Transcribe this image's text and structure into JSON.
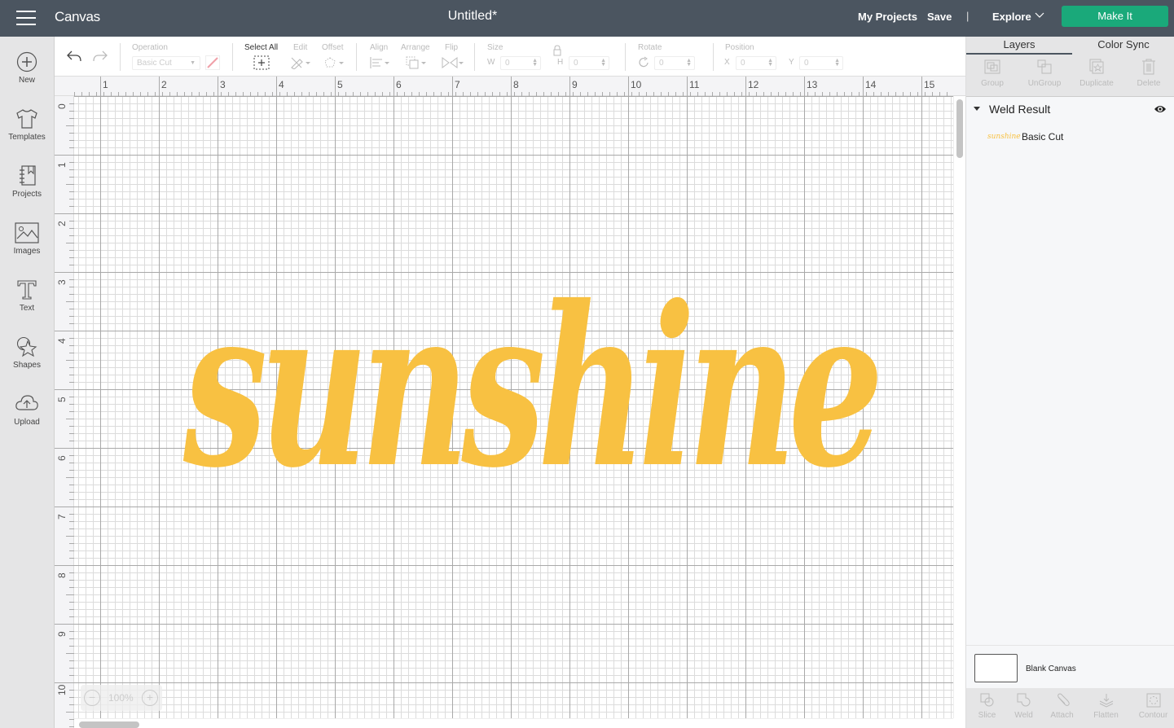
{
  "header": {
    "app_name": "Canvas",
    "doc_title": "Untitled*",
    "my_projects": "My Projects",
    "save": "Save",
    "divider": "|",
    "explore": "Explore",
    "make_it": "Make It",
    "colors": {
      "bar": "#4b5560",
      "make_it": "#1aa97a"
    }
  },
  "leftnav": {
    "items": [
      {
        "label": "New",
        "icon": "plus-circle-icon"
      },
      {
        "label": "Templates",
        "icon": "tshirt-icon"
      },
      {
        "label": "Projects",
        "icon": "notebook-icon"
      },
      {
        "label": "Images",
        "icon": "image-icon"
      },
      {
        "label": "Text",
        "icon": "text-icon"
      },
      {
        "label": "Shapes",
        "icon": "shapes-icon"
      },
      {
        "label": "Upload",
        "icon": "cloud-upload-icon"
      }
    ]
  },
  "toolbar": {
    "operation_label": "Operation",
    "operation_value": "Basic Cut",
    "select_all": "Select All",
    "edit": "Edit",
    "offset": "Offset",
    "align": "Align",
    "arrange": "Arrange",
    "flip": "Flip",
    "size": "Size",
    "w_label": "W",
    "w_value": "0",
    "h_label": "H",
    "h_value": "0",
    "rotate": "Rotate",
    "rotate_value": "0",
    "position": "Position",
    "x_label": "X",
    "x_value": "0",
    "y_label": "Y",
    "y_value": "0"
  },
  "rulers": {
    "top": [
      "1",
      "2",
      "3",
      "4",
      "5",
      "6",
      "7",
      "8",
      "9",
      "10",
      "11",
      "12",
      "13",
      "14",
      "15"
    ],
    "left": [
      "0",
      "1",
      "2",
      "3",
      "4",
      "5",
      "6",
      "7",
      "8",
      "9",
      "10"
    ]
  },
  "canvas": {
    "artwork_text": "sunshine",
    "artwork_color": "#f8c142",
    "zoom": "100%",
    "zoom_out": "−",
    "zoom_in": "+"
  },
  "panel": {
    "tabs": [
      "Layers",
      "Color Sync"
    ],
    "tools": [
      "Group",
      "UnGroup",
      "Duplicate",
      "Delete"
    ],
    "group_name": "Weld Result",
    "layer_thumb": "sunshine",
    "layer_name": "Basic Cut",
    "blank_canvas": "Blank Canvas",
    "bottom_tools": [
      "Slice",
      "Weld",
      "Attach",
      "Flatten",
      "Contour"
    ]
  }
}
